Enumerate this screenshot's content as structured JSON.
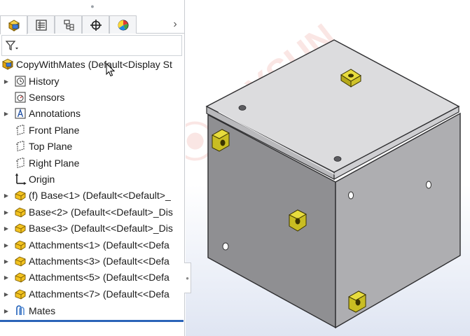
{
  "feature_tree": {
    "tabs": [
      {
        "name": "featuremanager",
        "active": true
      },
      {
        "name": "propertymanager",
        "active": false
      },
      {
        "name": "configurationmanager",
        "active": false
      },
      {
        "name": "dimxpertmanager",
        "active": false
      },
      {
        "name": "displaymanager",
        "active": false
      }
    ],
    "more_tabs_glyph": "›",
    "filter_icon": "filter-icon",
    "root": {
      "label": "CopyWithMates  (Default<Display St",
      "icon": "assembly-icon"
    },
    "items": [
      {
        "label": "History",
        "icon": "history-icon",
        "expandable": true
      },
      {
        "label": "Sensors",
        "icon": "sensors-icon",
        "expandable": false
      },
      {
        "label": "Annotations",
        "icon": "annotations-icon",
        "expandable": true
      },
      {
        "label": "Front Plane",
        "icon": "plane-icon",
        "expandable": false
      },
      {
        "label": "Top Plane",
        "icon": "plane-icon",
        "expandable": false
      },
      {
        "label": "Right Plane",
        "icon": "plane-icon",
        "expandable": false
      },
      {
        "label": "Origin",
        "icon": "origin-icon",
        "expandable": false
      },
      {
        "label": "(f) Base<1> (Default<<Default>_",
        "icon": "part-icon",
        "expandable": true
      },
      {
        "label": "Base<2> (Default<<Default>_Dis",
        "icon": "part-icon",
        "expandable": true
      },
      {
        "label": "Base<3> (Default<<Default>_Dis",
        "icon": "part-icon",
        "expandable": true
      },
      {
        "label": "Attachments<1> (Default<<Defa",
        "icon": "part-icon",
        "expandable": true
      },
      {
        "label": "Attachments<3> (Default<<Defa",
        "icon": "part-icon",
        "expandable": true
      },
      {
        "label": "Attachments<5> (Default<<Defa",
        "icon": "part-icon",
        "expandable": true
      },
      {
        "label": "Attachments<7> (Default<<Defa",
        "icon": "part-icon",
        "expandable": true
      },
      {
        "label": "Mates",
        "icon": "mates-icon",
        "expandable": true
      }
    ]
  },
  "colors": {
    "accent_blue": "#2b64b8",
    "part_yellow": "#f0c419",
    "bracket_yellow": "#d8cc28",
    "box_gray": "#9a9a9c"
  },
  "watermark_text": "JOYSUN"
}
